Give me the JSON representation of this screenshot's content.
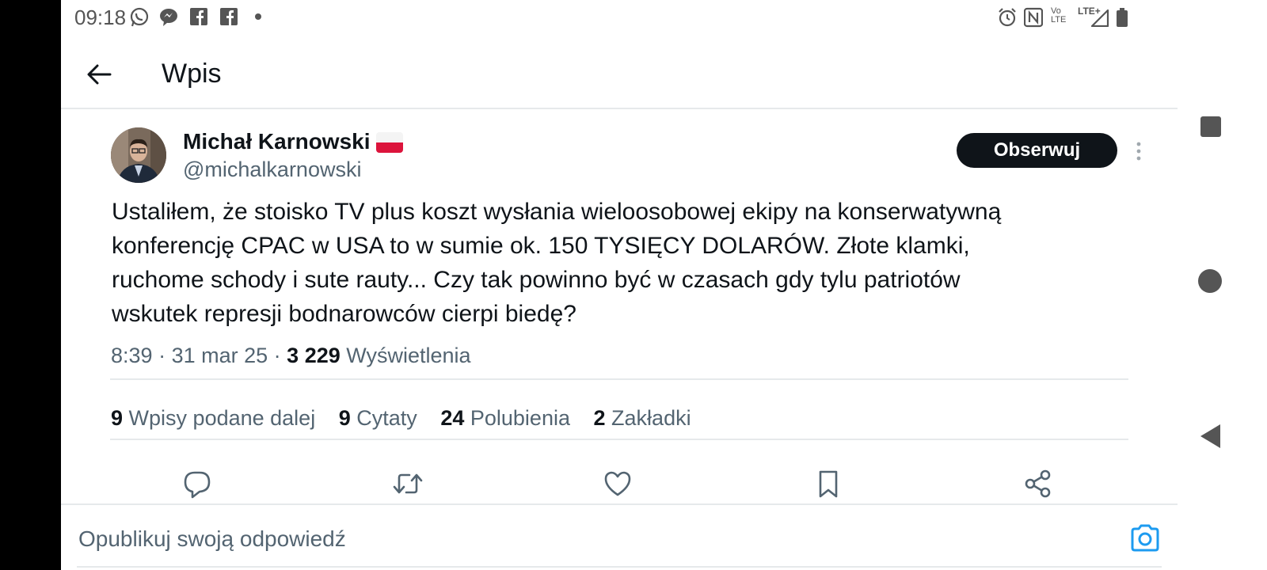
{
  "status_bar": {
    "time": "09:18",
    "network": "LTE+",
    "volte": "Vo LTE"
  },
  "header": {
    "title": "Wpis"
  },
  "tweet": {
    "author_name": "Michał Karnowski",
    "handle": "@michalkarnowski",
    "follow_label": "Obserwuj",
    "text": "Ustaliłem, że stoisko TV plus koszt wysłania wieloosobowej ekipy na konserwatywną\nkonferencję CPAC w USA to w sumie  ok. 150 TYSIĘCY DOLARÓW. Złote klamki,\nruchome schody i sute rauty... Czy tak powinno być w czasach gdy tylu patriotów\nwskutek represji bodnarowców cierpi biedę?",
    "time": "8:39",
    "date": "31 mar 25",
    "views_count": "3 229",
    "views_label": "Wyświetlenia"
  },
  "stats": [
    {
      "count": "9",
      "label": "Wpisy podane dalej"
    },
    {
      "count": "9",
      "label": "Cytaty"
    },
    {
      "count": "24",
      "label": "Polubienia"
    },
    {
      "count": "2",
      "label": "Zakładki"
    }
  ],
  "reply": {
    "placeholder": "Opublikuj swoją odpowiedź"
  },
  "colors": {
    "accent": "#1d9bf0",
    "text_primary": "#0f1419",
    "text_secondary": "#536471",
    "divider": "#e6e9eb"
  },
  "icons": {
    "status": [
      "whatsapp-icon",
      "messenger-icon",
      "facebook-icon",
      "facebook-icon",
      "dot-icon",
      "alarm-icon",
      "nfc-icon",
      "signal-icon",
      "battery-icon"
    ],
    "actions": [
      "reply-icon",
      "retweet-icon",
      "like-icon",
      "bookmark-icon",
      "share-icon"
    ]
  }
}
